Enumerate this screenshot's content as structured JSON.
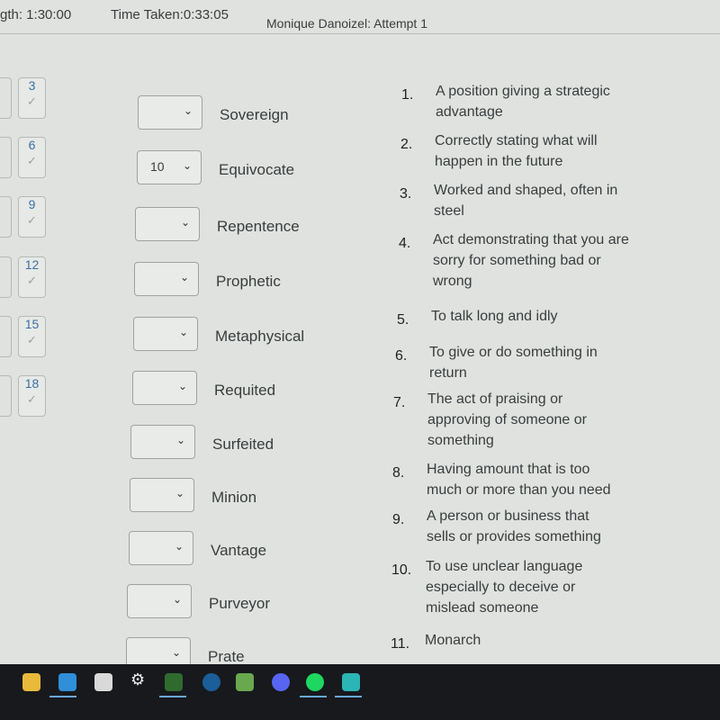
{
  "header": {
    "duration": "gth: 1:30:00",
    "time_taken": "Time Taken:0:33:05",
    "attempt": "Monique Danoizel: Attempt 1"
  },
  "nav": [
    "3",
    "6",
    "9",
    "12",
    "15",
    "18"
  ],
  "check_icon": "checkmark-icon",
  "rows": [
    {
      "word": "Sovereign",
      "value": ""
    },
    {
      "word": "Equivocate",
      "value": "10"
    },
    {
      "word": "Repentence",
      "value": ""
    },
    {
      "word": "Prophetic",
      "value": ""
    },
    {
      "word": "Metaphysical",
      "value": ""
    },
    {
      "word": "Requited",
      "value": ""
    },
    {
      "word": "Surfeited",
      "value": ""
    },
    {
      "word": "Minion",
      "value": ""
    },
    {
      "word": "Vantage",
      "value": ""
    },
    {
      "word": "Purveyor",
      "value": ""
    },
    {
      "word": "Prate",
      "value": ""
    }
  ],
  "definitions": [
    {
      "n": "1.",
      "text": "A position giving a strategic advantage"
    },
    {
      "n": "2.",
      "text": "Correctly stating what will happen in the future"
    },
    {
      "n": "3.",
      "text": "Worked and shaped, often in steel"
    },
    {
      "n": "4.",
      "text": "Act demonstrating that you are sorry for something bad or wrong"
    },
    {
      "n": "5.",
      "text": "To talk long and idly"
    },
    {
      "n": "6.",
      "text": "To give or do something in return"
    },
    {
      "n": "7.",
      "text": "The act of praising or approving of someone or something"
    },
    {
      "n": "8.",
      "text": "Having amount that is too much or more than you need"
    },
    {
      "n": "9.",
      "text": "A person or business that sells or provides something"
    },
    {
      "n": "10.",
      "text": "To use unclear language especially to deceive or mislead someone"
    },
    {
      "n": "11.",
      "text": "Monarch"
    }
  ],
  "taskbar": [
    "file-explorer-icon",
    "edge-icon",
    "store-icon",
    "settings-icon",
    "mg-app-icon",
    "steam-icon",
    "minecraft-icon",
    "discord-icon",
    "spotify-icon",
    "audio-app-icon"
  ]
}
